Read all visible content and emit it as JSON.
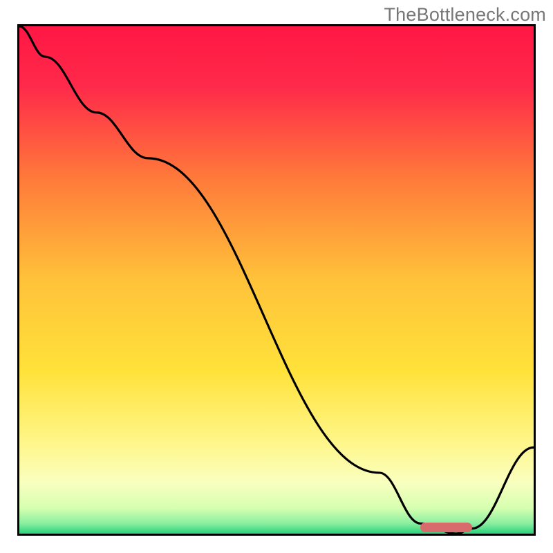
{
  "watermark": "TheBottleneck.com",
  "chart_data": {
    "type": "line",
    "title": "",
    "xlabel": "",
    "ylabel": "",
    "x_range": [
      0,
      100
    ],
    "y_range": [
      0,
      100
    ],
    "series": [
      {
        "name": "curve",
        "x": [
          0,
          5,
          15,
          25,
          70,
          78,
          85,
          88,
          100
        ],
        "y": [
          100,
          94,
          83,
          74,
          12,
          2,
          0,
          1,
          17
        ]
      }
    ],
    "marker": {
      "x_start": 78,
      "x_end": 88,
      "y": 0,
      "color": "#d86b6b"
    },
    "gradient_stops": [
      {
        "pct": 0,
        "color": "#ff1744"
      },
      {
        "pct": 12,
        "color": "#ff2a4a"
      },
      {
        "pct": 30,
        "color": "#ff7a3a"
      },
      {
        "pct": 50,
        "color": "#ffc23a"
      },
      {
        "pct": 68,
        "color": "#ffe23a"
      },
      {
        "pct": 82,
        "color": "#fff68a"
      },
      {
        "pct": 90,
        "color": "#f9ffbf"
      },
      {
        "pct": 95,
        "color": "#d5ffb0"
      },
      {
        "pct": 98,
        "color": "#8aeea0"
      },
      {
        "pct": 100,
        "color": "#29d37a"
      }
    ]
  }
}
